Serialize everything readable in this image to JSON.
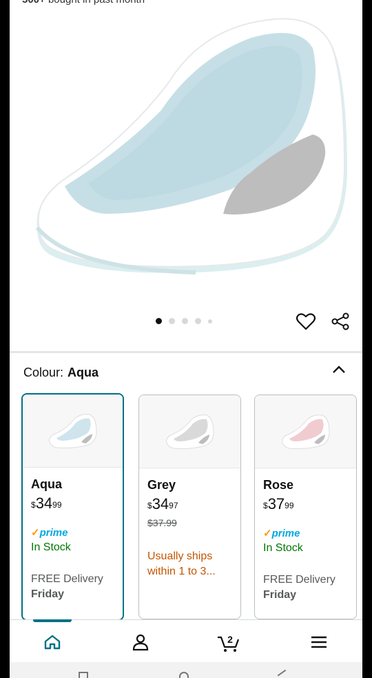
{
  "header": {
    "bought_count": "500+",
    "bought_text": "bought in past month"
  },
  "gallery": {
    "image_icon": "baby-bath-seat-image",
    "page_count": 5,
    "active_page": 1
  },
  "actions": {
    "favorite_icon": "heart-icon",
    "share_icon": "share-icon"
  },
  "colour": {
    "label": "Colour:",
    "selected": "Aqua",
    "collapse_icon": "chevron-up-icon"
  },
  "variants": [
    {
      "name": "Aqua",
      "price_symbol": "$",
      "price_whole": "34",
      "price_fraction": "99",
      "prime": "prime",
      "availability": "In Stock",
      "delivery": "FREE Delivery",
      "delivery_day": "Friday",
      "color": "#cfe4ec"
    },
    {
      "name": "Grey",
      "price_symbol": "$",
      "price_whole": "34",
      "price_fraction": "97",
      "was_price": "$37.99",
      "availability": "Usually ships within 1 to 3...",
      "color": "#d9d9d9"
    },
    {
      "name": "Rose",
      "price_symbol": "$",
      "price_whole": "37",
      "price_fraction": "99",
      "prime": "prime",
      "availability": "In Stock",
      "delivery": "FREE Delivery",
      "delivery_day": "Friday",
      "color": "#f0ccd0"
    }
  ],
  "bottom_nav": {
    "home_icon": "home-icon",
    "account_icon": "account-icon",
    "cart_icon": "cart-icon",
    "cart_count": "2",
    "menu_icon": "menu-icon"
  },
  "colors": {
    "accent": "#007185",
    "prime": "#00a8e1",
    "in_stock": "#007600",
    "ships": "#c45500"
  }
}
